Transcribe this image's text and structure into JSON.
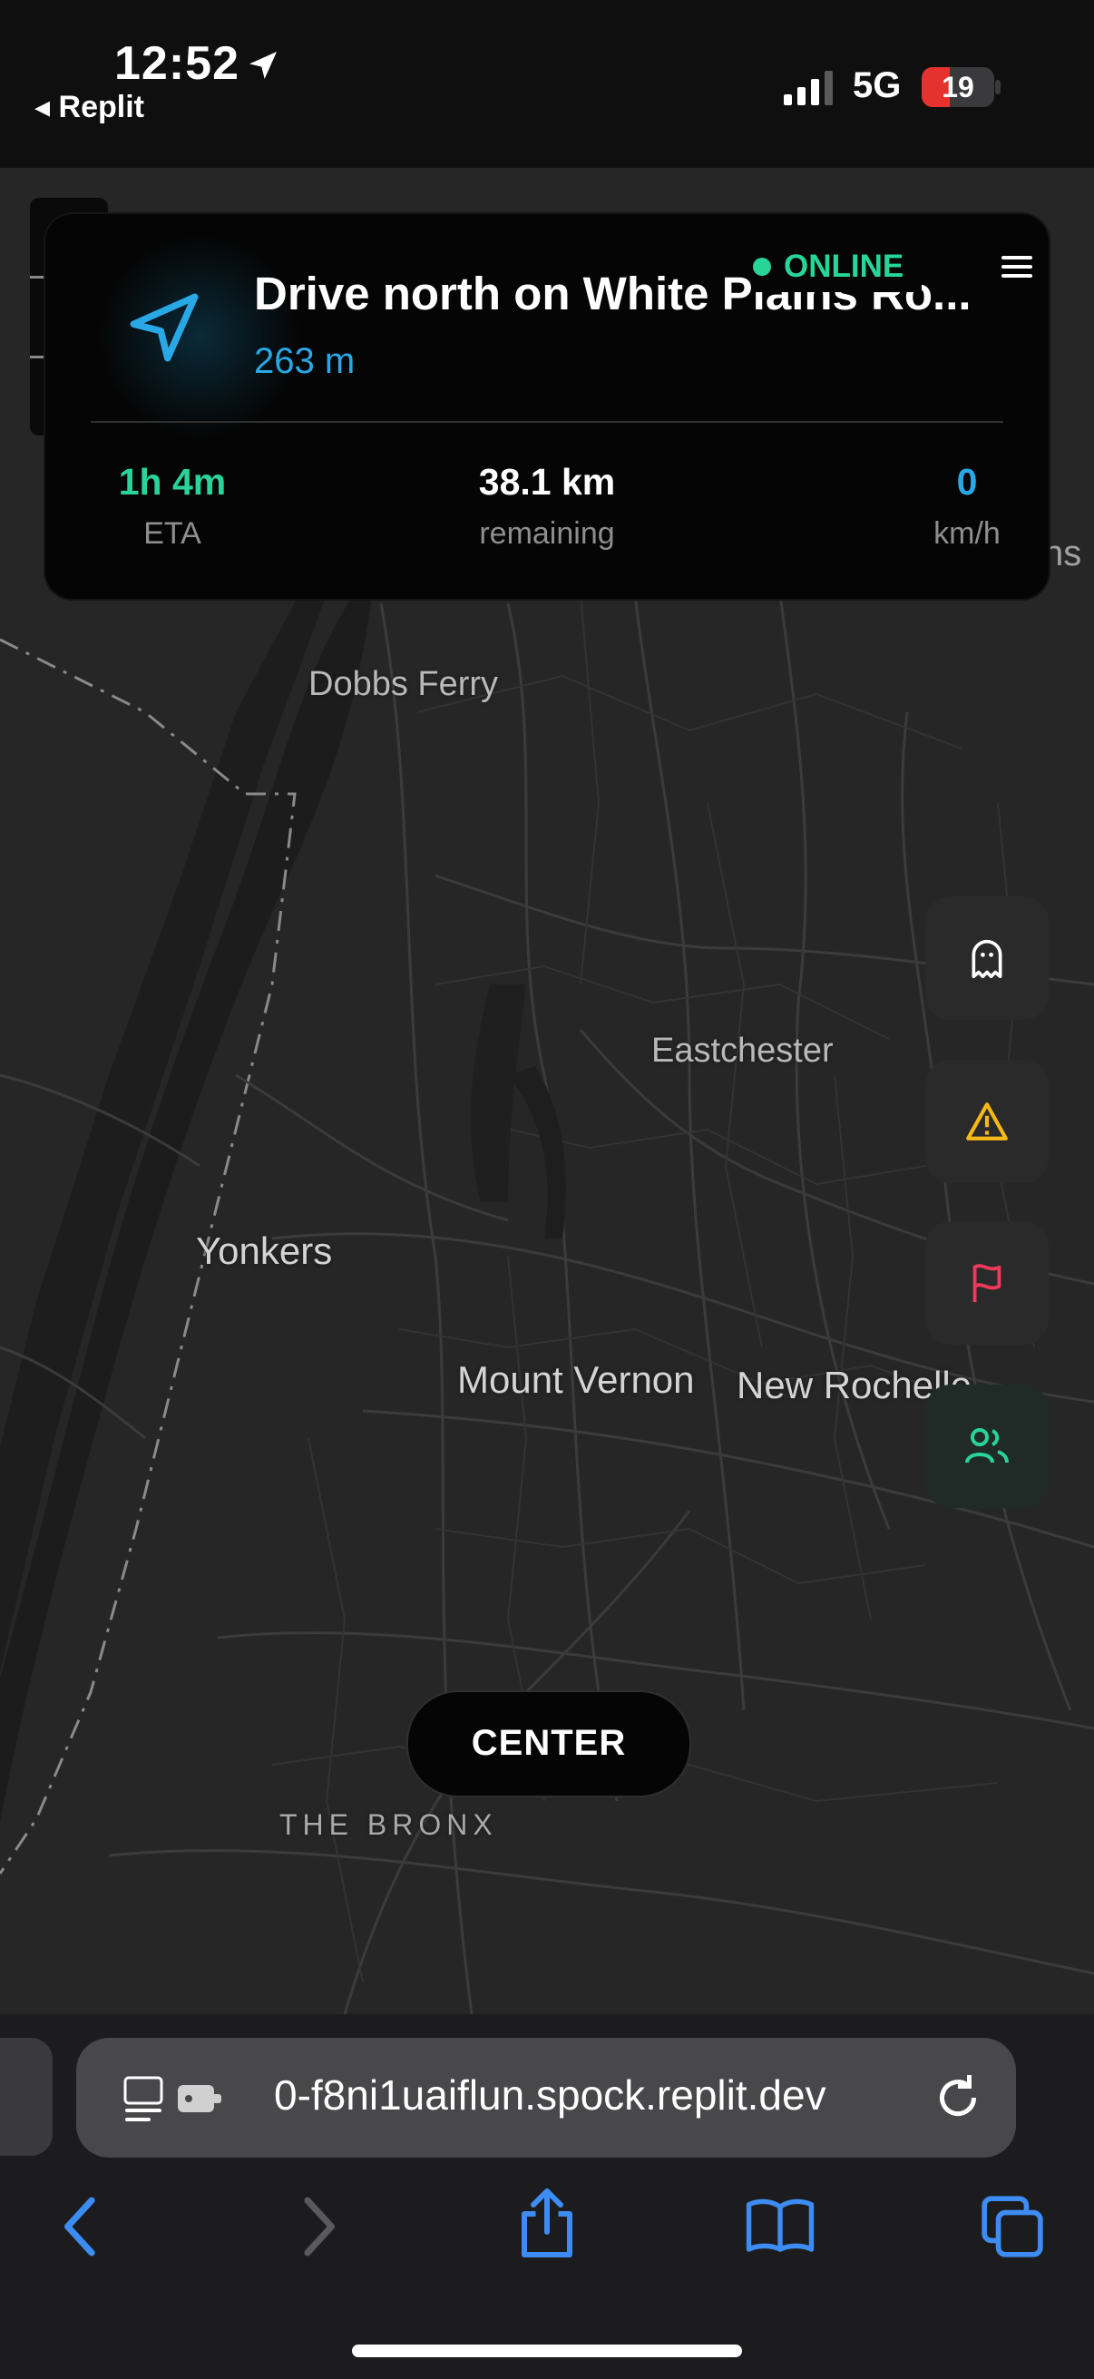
{
  "status_bar": {
    "time": "12:52",
    "back_app": "Replit",
    "network": "5G",
    "battery": "19",
    "battery_level": 0.19
  },
  "nav": {
    "instruction": "Drive north on White Plains Ro...",
    "distance": "263 m",
    "status": "ONLINE",
    "stats": [
      {
        "value": "1h 4m",
        "label": "ETA",
        "color": "#29d39b"
      },
      {
        "value": "38.1 km",
        "label": "remaining",
        "color": "#ffffff"
      },
      {
        "value": "0",
        "label": "km/h",
        "color": "#29a8e6"
      }
    ]
  },
  "map": {
    "places": {
      "dobbs_ferry": "Dobbs Ferry",
      "eastchester": "Eastchester",
      "yonkers": "Yonkers",
      "mount_vernon": "Mount Vernon",
      "new_rochelle": "New Rochelle",
      "bronx": "THE BRONX",
      "partial_label": "ns"
    }
  },
  "side_buttons": [
    {
      "name": "ghost-icon",
      "color": "#ffffff"
    },
    {
      "name": "warning-icon",
      "color": "#f5b916"
    },
    {
      "name": "flag-icon",
      "color": "#f0395a"
    },
    {
      "name": "users-icon",
      "color": "#29d39b"
    }
  ],
  "center_button": "CENTER",
  "browser": {
    "url": "0-f8ni1uaiflun.spock.replit.dev",
    "toolbar": [
      "back-icon",
      "forward-icon",
      "share-icon",
      "bookmarks-icon",
      "tabs-icon"
    ]
  }
}
